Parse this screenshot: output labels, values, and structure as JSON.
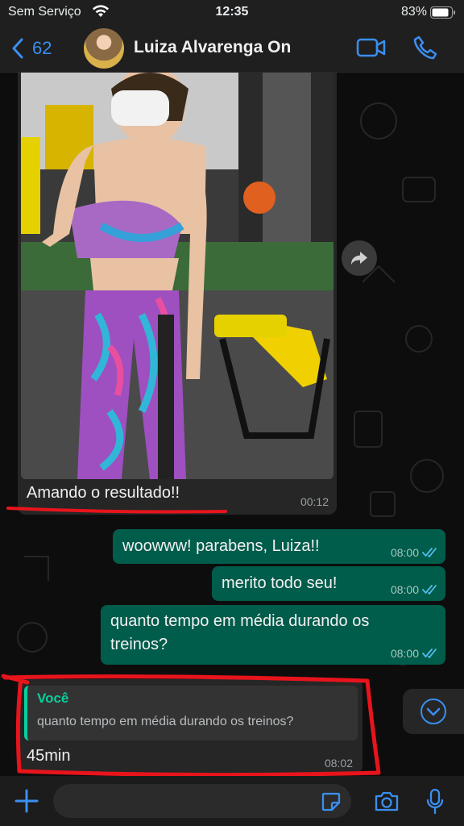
{
  "status_bar": {
    "carrier": "Sem Serviço",
    "time": "12:35",
    "battery": "83%"
  },
  "header": {
    "back_count": "62",
    "contact_name": "Luiza Alvarenga On"
  },
  "messages": [
    {
      "id": "m0",
      "direction": "in",
      "type": "image",
      "caption": "Amando o resultado!!",
      "time": "00:12"
    },
    {
      "id": "m1",
      "direction": "out",
      "text": "woowww! parabens, Luiza!!",
      "time": "08:00",
      "status": "read"
    },
    {
      "id": "m2",
      "direction": "out",
      "text": "merito todo seu!",
      "time": "08:00",
      "status": "read"
    },
    {
      "id": "m3",
      "direction": "out",
      "text": "quanto tempo em média durando os treinos?",
      "time": "08:00",
      "status": "read"
    },
    {
      "id": "m4",
      "direction": "in",
      "type": "reply",
      "quoted_author": "Você",
      "quoted_text": "quanto tempo em média durando os treinos?",
      "text": "45min",
      "time": "08:02"
    }
  ],
  "composer": {
    "placeholder": ""
  },
  "colors": {
    "accent": "#3a8ff0",
    "outgoing_bubble": "#005c4b",
    "incoming_bubble": "#262626",
    "quote_accent": "#06cf9c",
    "read_ticks": "#53bdeb",
    "annotation": "#e8141c"
  },
  "icons": {
    "back": "chevron-left-icon",
    "video": "video-camera-icon",
    "call": "phone-icon",
    "forward": "forward-arrow-icon",
    "scroll_down": "chevron-down-circle-icon",
    "attach": "plus-icon",
    "sticker": "sticker-icon",
    "camera": "camera-icon",
    "mic": "microphone-icon"
  }
}
